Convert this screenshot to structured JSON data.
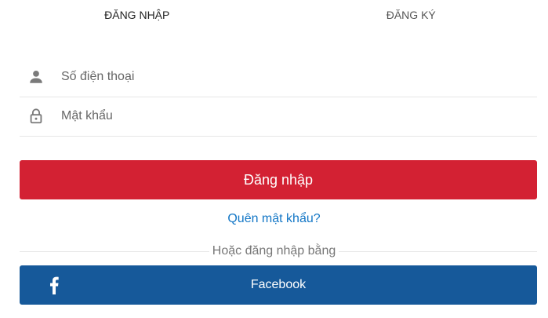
{
  "tabs": [
    {
      "label": "ĐĂNG NHẬP",
      "active": true
    },
    {
      "label": "ĐĂNG KÝ",
      "active": false
    }
  ],
  "form": {
    "phone": {
      "placeholder": "Số điện thoại",
      "value": "",
      "icon": "user-icon"
    },
    "password": {
      "placeholder": "Mật khẩu",
      "value": "",
      "icon": "lock-icon"
    }
  },
  "login_button": {
    "label": "Đăng nhập"
  },
  "forgot_password": {
    "label": "Quên mật khẩu?"
  },
  "divider": {
    "label": "Hoặc đăng nhập bằng"
  },
  "facebook_button": {
    "label": "Facebook",
    "icon": "facebook-icon"
  },
  "colors": {
    "login_red": "#d32133",
    "facebook_blue": "#16599a",
    "link_blue": "#1276c6",
    "icon_grey": "#7a7a7a"
  }
}
